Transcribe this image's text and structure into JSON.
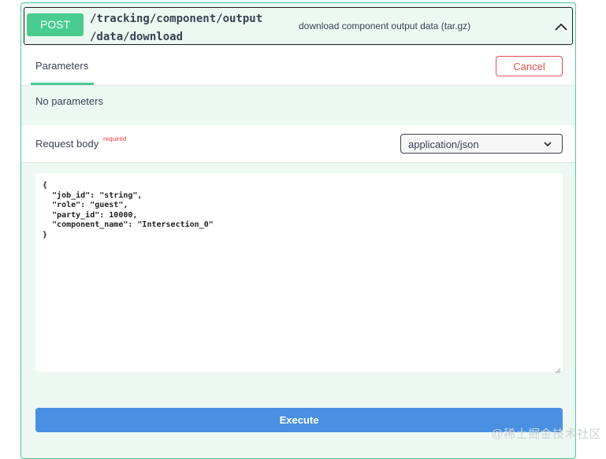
{
  "operation": {
    "method": "POST",
    "path_line1": "/tracking/component/output",
    "path_line2": "/data/download",
    "summary": "download component output data (tar.gz)"
  },
  "parameters": {
    "tab_label": "Parameters",
    "cancel_label": "Cancel",
    "empty_text": "No parameters"
  },
  "request_body": {
    "label": "Request body",
    "required_label": "required",
    "content_type": "application/json",
    "example": "{\n  \"job_id\": \"string\",\n  \"role\": \"guest\",\n  \"party_id\": 10000,\n  \"component_name\": \"Intersection_0\"\n}"
  },
  "execute_label": "Execute",
  "watermark": "@稀土掘金技术社区",
  "colors": {
    "method_post": "#49cc90",
    "cancel": "#e35050",
    "execute": "#4990e2",
    "required": "#f93e3e"
  }
}
